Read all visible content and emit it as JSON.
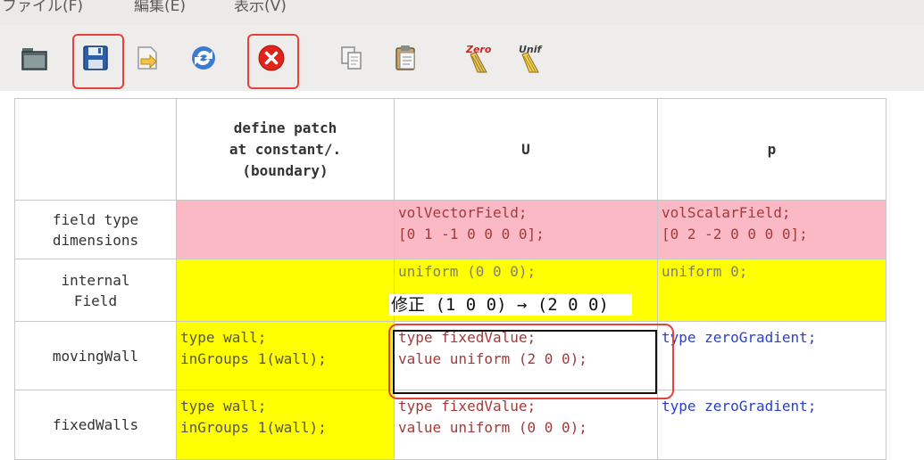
{
  "menu": {
    "items": [
      "ファイル(F)",
      "編集(E)",
      "表示(V)"
    ]
  },
  "toolbar": {
    "buttons": [
      {
        "icon": "folder-icon"
      },
      {
        "icon": "save-icon",
        "highlighted": true
      },
      {
        "icon": "import-arrow-icon"
      },
      {
        "icon": "refresh-icon"
      },
      {
        "icon": "close-icon",
        "highlighted": true
      },
      {
        "icon": "copy-icon"
      },
      {
        "icon": "paste-icon"
      },
      {
        "icon": "zero-clear-icon",
        "label": "Zero"
      },
      {
        "icon": "unif-clear-icon",
        "label": "Unif"
      }
    ],
    "highlight_color": "#e8413c"
  },
  "table": {
    "headers": [
      "",
      "define patch\nat constant/.\n(boundary)",
      "U",
      "p"
    ],
    "rows": [
      {
        "label": "field type\ndimensions",
        "cells": [
          {
            "text": "",
            "bg": "#fbb9c5"
          },
          {
            "text": "volVectorField;\n[0 1 -1 0 0 0 0];",
            "bg": "#fbb9c5",
            "color": "#a33a3a"
          },
          {
            "text": "volScalarField;\n[0 2 -2 0 0 0 0];",
            "bg": "#fbb9c5",
            "color": "#a33a3a"
          }
        ]
      },
      {
        "label": "internal\nField",
        "cells": [
          {
            "text": "",
            "bg": "#ffff00"
          },
          {
            "text": "uniform (0 0 0);",
            "bg": "#ffff00",
            "color": "#7d7d7d"
          },
          {
            "text": "uniform 0;",
            "bg": "#ffff00",
            "color": "#7d7d7d"
          }
        ]
      },
      {
        "label": "movingWall",
        "cells": [
          {
            "text": "type wall;\ninGroups 1(wall);",
            "bg": "#ffff00",
            "color": "#555555"
          },
          {
            "text": "type fixedValue;\nvalue uniform (2 0 0);",
            "bg": "#ffffff",
            "color": "#a33a3a"
          },
          {
            "text": "type zeroGradient;",
            "bg": "#ffffff",
            "color": "#2b3fc8"
          }
        ]
      },
      {
        "label": "fixedWalls",
        "cells": [
          {
            "text": "type wall;\ninGroups 1(wall);",
            "bg": "#ffff00",
            "color": "#555555"
          },
          {
            "text": "type fixedValue;\nvalue uniform (0 0 0);",
            "bg": "#ffffff",
            "color": "#a33a3a"
          },
          {
            "text": "type zeroGradient;",
            "bg": "#ffffff",
            "color": "#2b3fc8"
          }
        ]
      }
    ]
  },
  "annotation": {
    "text": "修正 (1 0 0) → (2 0 0)"
  }
}
